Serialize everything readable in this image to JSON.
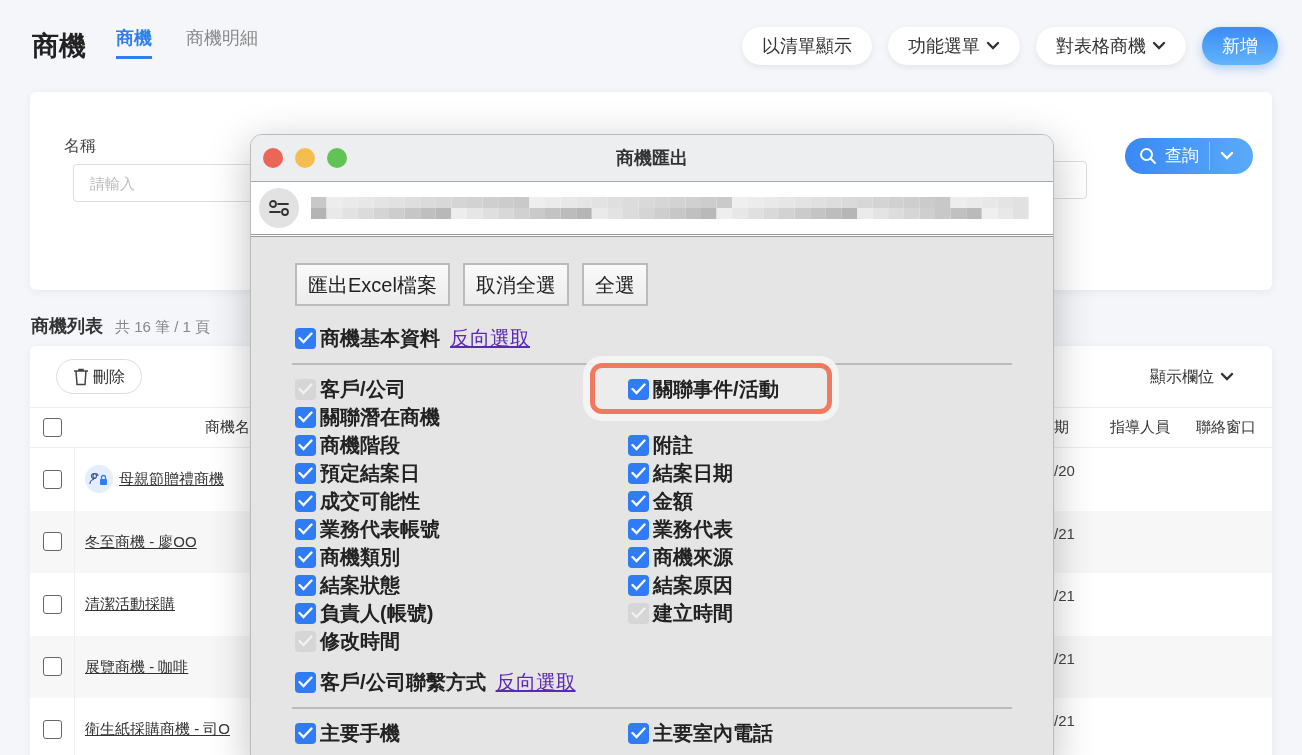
{
  "header": {
    "title": "商機",
    "tabs": [
      {
        "label": "商機",
        "selected": true
      },
      {
        "label": "商機明細",
        "selected": false
      }
    ],
    "actions": [
      {
        "label": "以清單顯示",
        "kind": "plain"
      },
      {
        "label": "功能選單",
        "kind": "dropdown"
      },
      {
        "label": "對表格商機",
        "kind": "dropdown"
      },
      {
        "label": "新增",
        "kind": "primary"
      }
    ]
  },
  "search": {
    "fields": [
      {
        "label": "名稱",
        "placeholder": "請輸入"
      }
    ],
    "button": "查詢"
  },
  "list": {
    "title": "商機列表",
    "summary": "共 16 筆 / 1 頁",
    "delete_button": "刪除",
    "columns_button": "顯示欄位",
    "select_all": {
      "checked": false
    },
    "columns": [
      "商機名",
      "期",
      "指導人員",
      "聯絡窗口"
    ],
    "rows": [
      {
        "name": "母親節贈禮商機",
        "shared": true,
        "date": "/20",
        "checked": false
      },
      {
        "name": "冬至商機 - 廖OO",
        "shared": false,
        "date": "/21",
        "checked": false
      },
      {
        "name": "清潔活動採購",
        "shared": false,
        "date": "/21",
        "checked": false
      },
      {
        "name": "展覽商機 - 咖啡",
        "shared": false,
        "date": "/21",
        "checked": false
      },
      {
        "name": "衛生紙採購商機 - 司O",
        "shared": false,
        "date": "/21",
        "checked": false
      }
    ]
  },
  "dialog": {
    "title": "商機匯出",
    "buttons": [
      "匯出Excel檔案",
      "取消全選",
      "全選"
    ],
    "sections": [
      {
        "label": "商機基本資料",
        "checked": true,
        "link": "反向選取",
        "columns": [
          [
            {
              "label": "客戶/公司",
              "checked": true,
              "disabled": true,
              "highlighted": false
            },
            {
              "label": "關聯潛在商機",
              "checked": true,
              "disabled": false,
              "highlighted": false
            },
            {
              "label": "商機階段",
              "checked": true,
              "disabled": false,
              "highlighted": false
            },
            {
              "label": "預定結案日",
              "checked": true,
              "disabled": false,
              "highlighted": false
            },
            {
              "label": "成交可能性",
              "checked": true,
              "disabled": false,
              "highlighted": false
            },
            {
              "label": "業務代表帳號",
              "checked": true,
              "disabled": false,
              "highlighted": false
            },
            {
              "label": "商機類別",
              "checked": true,
              "disabled": false,
              "highlighted": false
            },
            {
              "label": "結案狀態",
              "checked": true,
              "disabled": false,
              "highlighted": false
            },
            {
              "label": "負責人(帳號)",
              "checked": true,
              "disabled": false,
              "highlighted": false
            },
            {
              "label": "修改時間",
              "checked": true,
              "disabled": true,
              "highlighted": false
            }
          ],
          [
            {
              "label": "關聯事件/活動",
              "checked": true,
              "disabled": false,
              "highlighted": true
            },
            {
              "label": "附註",
              "checked": true,
              "disabled": false,
              "highlighted": false
            },
            {
              "label": "結案日期",
              "checked": true,
              "disabled": false,
              "highlighted": false
            },
            {
              "label": "金額",
              "checked": true,
              "disabled": false,
              "highlighted": false
            },
            {
              "label": "業務代表",
              "checked": true,
              "disabled": false,
              "highlighted": false
            },
            {
              "label": "商機來源",
              "checked": true,
              "disabled": false,
              "highlighted": false
            },
            {
              "label": "結案原因",
              "checked": true,
              "disabled": false,
              "highlighted": false
            },
            {
              "label": "建立時間",
              "checked": true,
              "disabled": true,
              "highlighted": false
            }
          ]
        ]
      },
      {
        "label": "客戶/公司聯繫方式",
        "checked": true,
        "link": "反向選取",
        "columns": [
          [
            {
              "label": "主要手機",
              "checked": true,
              "disabled": false,
              "highlighted": false
            }
          ],
          [
            {
              "label": "主要室內電話",
              "checked": true,
              "disabled": false,
              "highlighted": false
            }
          ]
        ]
      }
    ]
  }
}
